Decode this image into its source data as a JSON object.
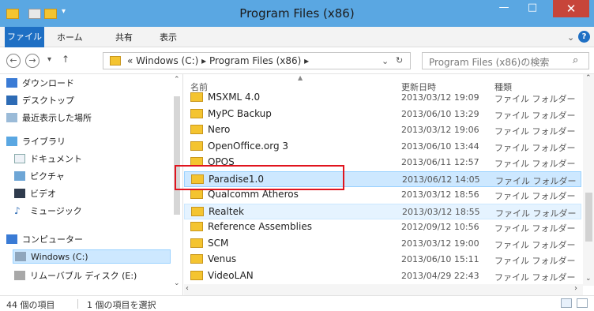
{
  "window": {
    "title": "Program Files (x86)",
    "min_glyph": "—",
    "max_glyph": "□",
    "close_glyph": "✕"
  },
  "ribbon": {
    "tabs": [
      "ファイル",
      "ホーム",
      "共有",
      "表示"
    ],
    "collapse_glyph": "⌄",
    "help_glyph": "?"
  },
  "address": {
    "back_glyph": "←",
    "forward_glyph": "→",
    "dropdown_glyph": "▾",
    "up_glyph": "↑",
    "crumbs": "« Windows (C:) ▸ Program Files (x86) ▸",
    "history_glyph": "⌄",
    "refresh_glyph": "↻",
    "search_placeholder": "Program Files (x86)の検索",
    "search_glyph": "⌕"
  },
  "navpane": {
    "items": [
      {
        "label": "ダウンロード",
        "icon": "downloads-icon"
      },
      {
        "label": "デスクトップ",
        "icon": "desktop-icon"
      },
      {
        "label": "最近表示した場所",
        "icon": "recent-places-icon"
      },
      {
        "label": "ライブラリ",
        "icon": "libraries-icon"
      },
      {
        "label": "ドキュメント",
        "icon": "documents-icon"
      },
      {
        "label": "ピクチャ",
        "icon": "pictures-icon"
      },
      {
        "label": "ビデオ",
        "icon": "videos-icon"
      },
      {
        "label": "ミュージック",
        "icon": "music-icon"
      },
      {
        "label": "コンピューター",
        "icon": "computer-icon"
      },
      {
        "label": "Windows (C:)",
        "icon": "drive-icon"
      },
      {
        "label": "リムーバブル ディスク (E:)",
        "icon": "removable-disk-icon"
      }
    ],
    "selected_index": 9
  },
  "list": {
    "columns": {
      "name": "名前",
      "date": "更新日時",
      "type": "種類"
    },
    "rows": [
      {
        "name": "MSXML 4.0",
        "date": "2013/03/12 19:09",
        "type": "ファイル フォルダー"
      },
      {
        "name": "MyPC Backup",
        "date": "2013/06/10 13:29",
        "type": "ファイル フォルダー"
      },
      {
        "name": "Nero",
        "date": "2013/03/12 19:06",
        "type": "ファイル フォルダー"
      },
      {
        "name": "OpenOffice.org 3",
        "date": "2013/06/10 13:44",
        "type": "ファイル フォルダー"
      },
      {
        "name": "OPOS",
        "date": "2013/06/11 12:57",
        "type": "ファイル フォルダー"
      },
      {
        "name": "Paradise1.0",
        "date": "2013/06/12 14:05",
        "type": "ファイル フォルダー"
      },
      {
        "name": "Qualcomm Atheros",
        "date": "2013/03/12 18:56",
        "type": "ファイル フォルダー"
      },
      {
        "name": "Realtek",
        "date": "2013/03/12 18:55",
        "type": "ファイル フォルダー"
      },
      {
        "name": "Reference Assemblies",
        "date": "2012/09/12 10:56",
        "type": "ファイル フォルダー"
      },
      {
        "name": "SCM",
        "date": "2013/03/12 19:00",
        "type": "ファイル フォルダー"
      },
      {
        "name": "Venus",
        "date": "2013/06/10 15:11",
        "type": "ファイル フォルダー"
      },
      {
        "name": "VideoLAN",
        "date": "2013/04/29 22:43",
        "type": "ファイル フォルダー"
      }
    ],
    "selected_index": 5,
    "hover_index": 7
  },
  "status": {
    "item_count": "44 個の項目",
    "selected_count": "1 個の項目を選択"
  },
  "colors": {
    "titlebar": "#5aa7e2",
    "file_tab": "#1e6fc4",
    "close": "#c7453a",
    "selection": "#cde8ff",
    "annotation": "#e0141e",
    "folder": "#f4c430"
  }
}
